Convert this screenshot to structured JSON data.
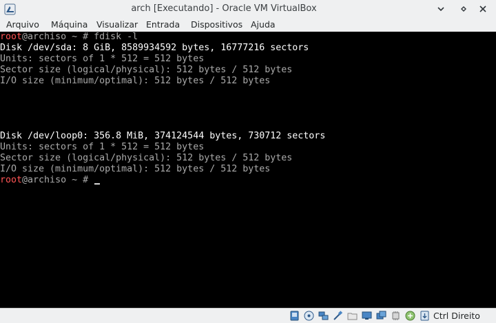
{
  "window": {
    "title": "arch [Executando] - Oracle VM VirtualBox",
    "controls": [
      "minimize",
      "restore",
      "close"
    ]
  },
  "menu": {
    "items": [
      "Arquivo",
      "Máquina",
      "Visualizar",
      "Entrada",
      "Dispositivos",
      "Ajuda"
    ]
  },
  "terminal": {
    "prompt_user": "root",
    "prompt_host": "@archiso ~ # ",
    "command": "fdisk -l",
    "output": {
      "sda_disk": "Disk /dev/sda: 8 GiB, 8589934592 bytes, 16777216 sectors",
      "sda_units": "Units: sectors of 1 * 512 = 512 bytes",
      "sda_sector": "Sector size (logical/physical): 512 bytes / 512 bytes",
      "sda_io": "I/O size (minimum/optimal): 512 bytes / 512 bytes",
      "loop_disk": "Disk /dev/loop0: 356.8 MiB, 374124544 bytes, 730712 sectors",
      "loop_units": "Units: sectors of 1 * 512 = 512 bytes",
      "loop_sector": "Sector size (logical/physical): 512 bytes / 512 bytes",
      "loop_io": "I/O size (minimum/optimal): 512 bytes / 512 bytes"
    },
    "colors": {
      "prompt_user": "#ff5555",
      "bold_text": "#ffffff",
      "normal_text": "#aaaaaa"
    }
  },
  "statusbar": {
    "icons": [
      "hard-disk-icon",
      "optical-disk-icon",
      "network-icon",
      "usb-icon",
      "shared-folders-icon",
      "display-icon",
      "video-capture-icon",
      "cpu-icon",
      "mouse-integration-icon",
      "keyboard-capture-icon"
    ],
    "host_key": "Ctrl Direito"
  }
}
